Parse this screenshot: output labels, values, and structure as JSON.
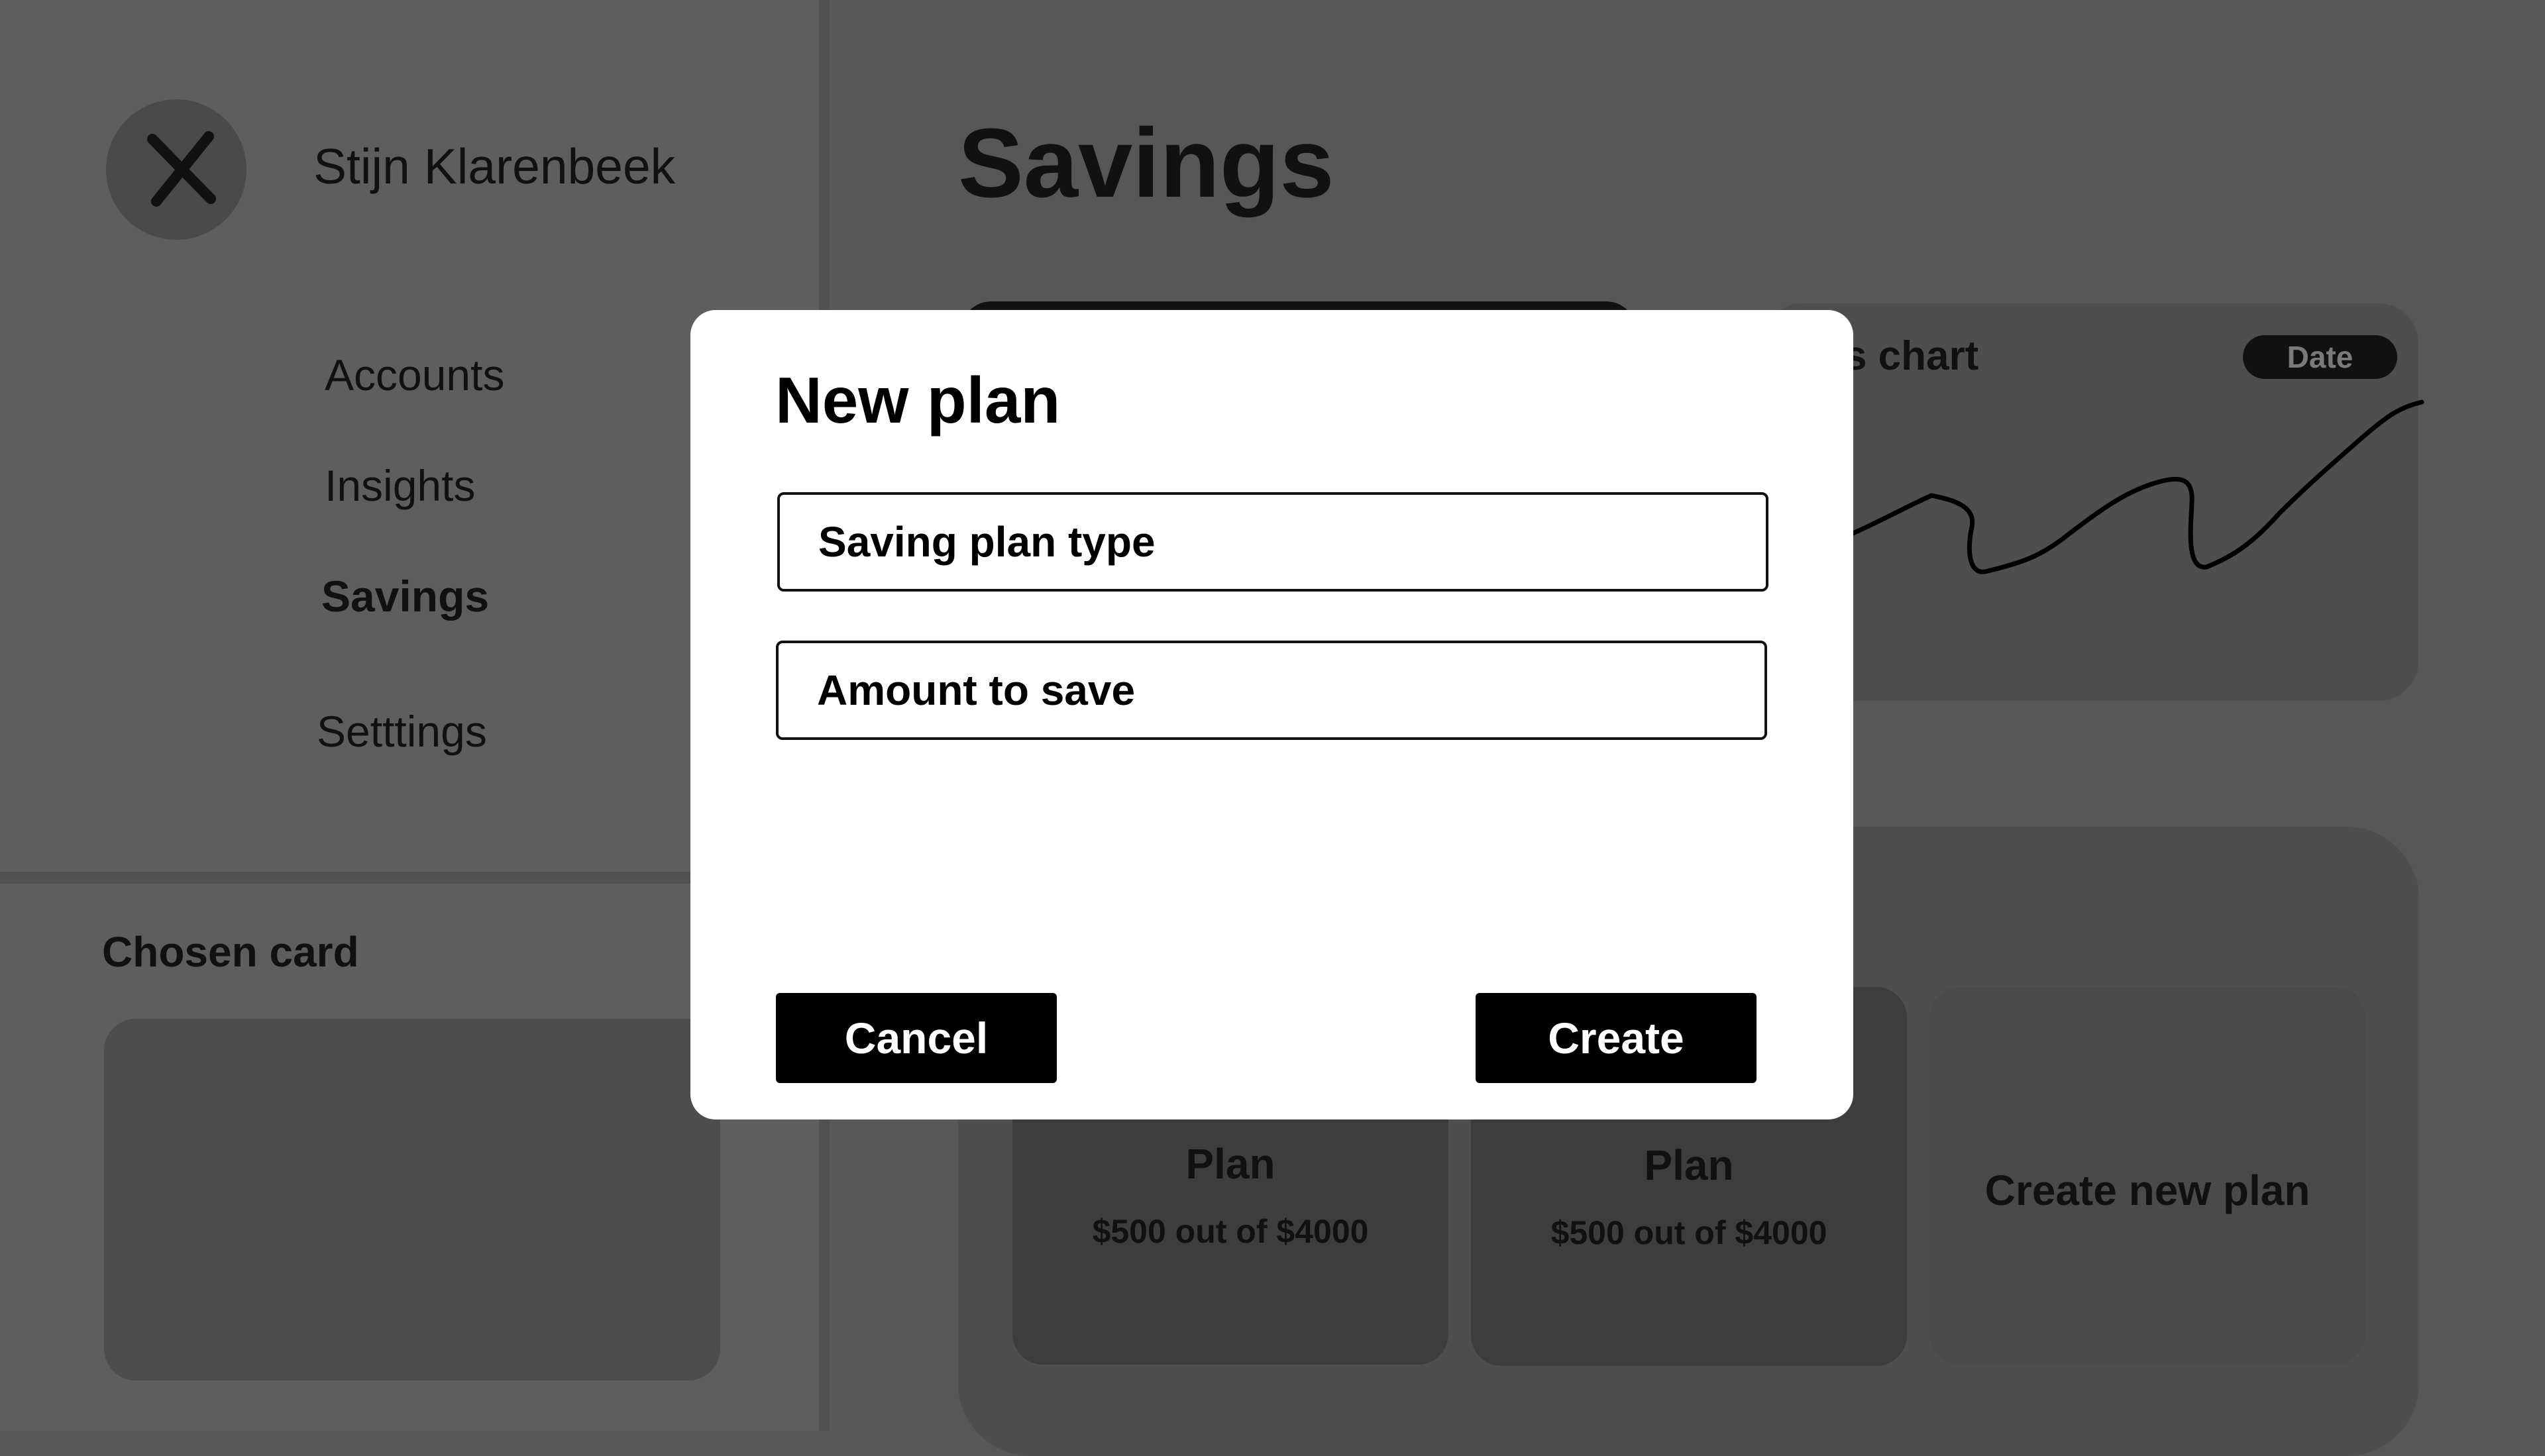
{
  "sidebar": {
    "user_name": "Stijn Klarenbeek",
    "avatar_icon": "close-icon",
    "nav": [
      {
        "label": "Accounts",
        "active": false
      },
      {
        "label": "Insights",
        "active": false
      },
      {
        "label": "Savings",
        "active": true
      },
      {
        "label": "Setttings",
        "active": false
      }
    ],
    "chosen_card_title": "Chosen card"
  },
  "main": {
    "title": "Savings",
    "chart": {
      "title_visible": "ings chart",
      "date_label": "Date"
    },
    "plans": [
      {
        "title": "Plan",
        "progress": "$500 out of $4000",
        "saved": 500,
        "goal": 4000
      },
      {
        "title": "Plan",
        "progress": "$500 out of $4000",
        "saved": 500,
        "goal": 4000
      }
    ],
    "create_plan_label": "Create new plan"
  },
  "modal": {
    "title": "New plan",
    "fields": [
      {
        "placeholder": "Saving plan type",
        "value": ""
      },
      {
        "placeholder": "Amount to save",
        "value": ""
      }
    ],
    "cancel_label": "Cancel",
    "create_label": "Create"
  },
  "colors": {
    "overlay_background": "#575757",
    "modal_background": "#ffffff",
    "button_background": "#000000",
    "button_text": "#ffffff"
  }
}
